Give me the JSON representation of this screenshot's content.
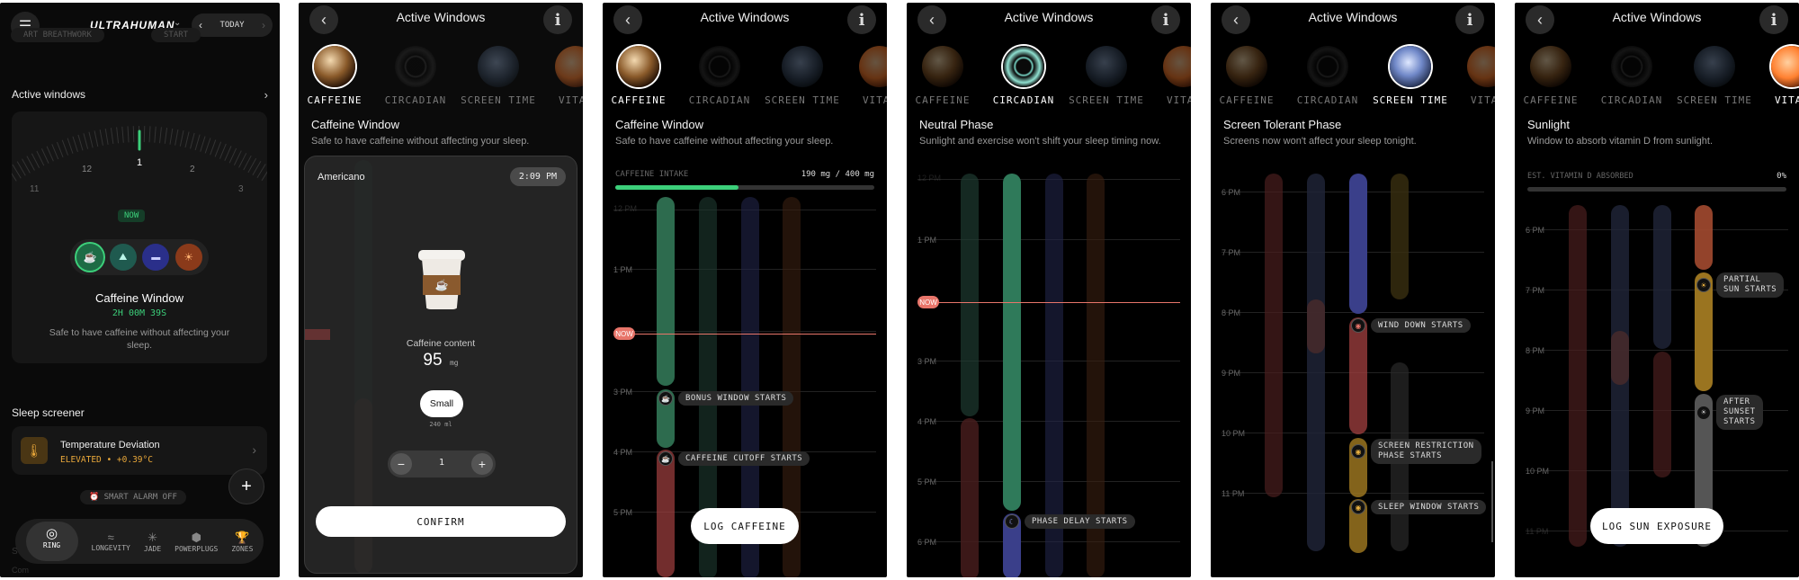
{
  "s1": {
    "app_name": "ULTRAHUMAN",
    "date_nav": "TODAY",
    "chips": [
      "ART BREATHWORK",
      "START"
    ],
    "active_windows_title": "Active windows",
    "dial_labels": [
      "11",
      "12",
      "1",
      "2",
      "3"
    ],
    "now_badge": "NOW",
    "window_title": "Caffeine Window",
    "countdown": "2H 00M 39S",
    "window_desc": "Safe to have caffeine without affecting your sleep.",
    "sleep_screener_title": "Sleep screener",
    "temp_title": "Temperature Deviation",
    "temp_status": "ELEVATED • +0.39°C",
    "smart_alarm": "SMART ALARM OFF",
    "nav": [
      "RING",
      "LONGEVITY",
      "JADE",
      "POWERPLUGS",
      "ZONES"
    ],
    "bottom_ghost": [
      "S",
      "Com"
    ]
  },
  "header_title": "Active Windows",
  "tabs": [
    "CAFFEINE",
    "CIRCADIAN",
    "SCREEN TIME",
    "VITAM"
  ],
  "s2": {
    "phase_title": "Caffeine Window",
    "phase_sub": "Safe to have caffeine without affecting your sleep.",
    "drink_name": "Americano",
    "time": "2:09 PM",
    "content_label": "Caffeine content",
    "content_value": "95",
    "content_unit": "mg",
    "size_label": "Small",
    "size_ml": "240 ml",
    "qty": "1",
    "confirm": "CONFIRM"
  },
  "s3": {
    "phase_title": "Caffeine Window",
    "phase_sub": "Safe to have caffeine without affecting your sleep.",
    "intake_label": "CAFFEINE INTAKE",
    "intake_value": "190 mg / 400 mg",
    "intake_fraction": 0.475,
    "times": [
      "12 PM",
      "1 PM",
      "3 PM",
      "4 PM",
      "5 PM"
    ],
    "now": "NOW",
    "evt1": "BONUS WINDOW STARTS",
    "evt2": "CAFFEINE CUTOFF STARTS",
    "btn": "LOG CAFFEINE"
  },
  "s4": {
    "phase_title": "Neutral Phase",
    "phase_sub": "Sunlight and exercise won't shift your sleep timing now.",
    "times": [
      "12 PM",
      "1 PM",
      "3 PM",
      "4 PM",
      "5 PM",
      "6 PM"
    ],
    "now": "NOW",
    "evt1": "PHASE DELAY STARTS"
  },
  "s5": {
    "phase_title": "Screen Tolerant Phase",
    "phase_sub": "Screens now won't affect your sleep tonight.",
    "times": [
      "6 PM",
      "7 PM",
      "8 PM",
      "9 PM",
      "10 PM",
      "11 PM"
    ],
    "evt1": "WIND DOWN STARTS",
    "evt2a": "SCREEN RESTRICTION",
    "evt2b": "PHASE STARTS",
    "evt3": "SLEEP WINDOW STARTS"
  },
  "s6": {
    "phase_title": "Sunlight",
    "phase_sub": "Window to absorb vitamin D from sunlight.",
    "vit_label": "EST. VITAMIN D ABSORBED",
    "vit_value": "0%",
    "vit_fraction": 0,
    "times": [
      "6 PM",
      "7 PM",
      "8 PM",
      "9 PM",
      "10 PM",
      "11 PM"
    ],
    "evt1a": "PARTIAL",
    "evt1b": "SUN STARTS",
    "evt2a": "AFTER",
    "evt2b": "SUNSET",
    "evt2c": "STARTS",
    "btn": "LOG SUN EXPOSURE"
  },
  "colors": {
    "caffeine_track": "#2d6b4e",
    "circadian_track": "#2f7a5a",
    "screen_track": "#3a3f8a",
    "warm_track": "#a34040",
    "amber_track": "#9a7420",
    "now_red": "#e8756a",
    "accent_green": "#3ccf7a"
  }
}
